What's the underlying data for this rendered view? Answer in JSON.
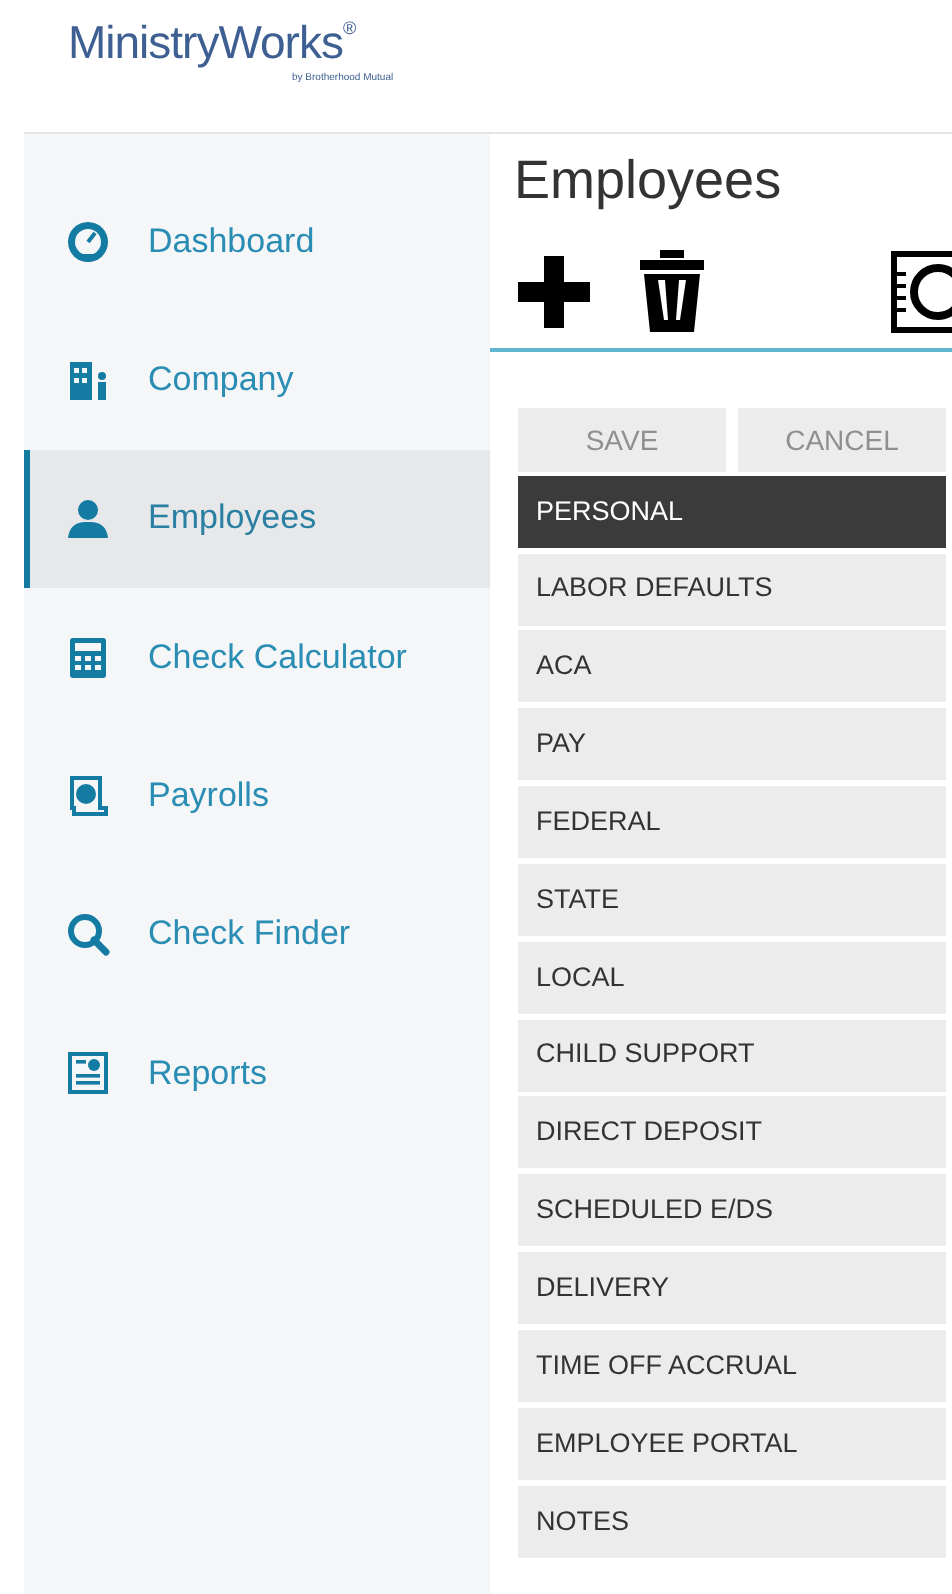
{
  "logo": {
    "name": "MinistryWorks",
    "mark": "®",
    "tagline": "by Brotherhood Mutual"
  },
  "sidebar": {
    "items": [
      {
        "label": "Dashboard",
        "selected": false
      },
      {
        "label": "Company",
        "selected": false
      },
      {
        "label": "Employees",
        "selected": true
      },
      {
        "label": "Check Calculator",
        "selected": false
      },
      {
        "label": "Payrolls",
        "selected": false
      },
      {
        "label": "Check Finder",
        "selected": false
      },
      {
        "label": "Reports",
        "selected": false
      }
    ]
  },
  "page": {
    "title": "Employees",
    "buttons": [
      {
        "label": "SAVE",
        "disabled": true
      },
      {
        "label": "CANCEL",
        "disabled": true
      }
    ],
    "sections": [
      {
        "label": "PERSONAL",
        "selected": true
      },
      {
        "label": "LABOR DEFAULTS",
        "selected": false
      },
      {
        "label": "ACA",
        "selected": false
      },
      {
        "label": "PAY",
        "selected": false
      },
      {
        "label": "FEDERAL",
        "selected": false
      },
      {
        "label": "STATE",
        "selected": false
      },
      {
        "label": "LOCAL",
        "selected": false
      },
      {
        "label": "CHILD SUPPORT",
        "selected": false
      },
      {
        "label": "DIRECT DEPOSIT",
        "selected": false
      },
      {
        "label": "SCHEDULED E/DS",
        "selected": false
      },
      {
        "label": "DELIVERY",
        "selected": false
      },
      {
        "label": "TIME OFF ACCRUAL",
        "selected": false
      },
      {
        "label": "EMPLOYEE PORTAL",
        "selected": false
      },
      {
        "label": "NOTES",
        "selected": false
      }
    ]
  }
}
